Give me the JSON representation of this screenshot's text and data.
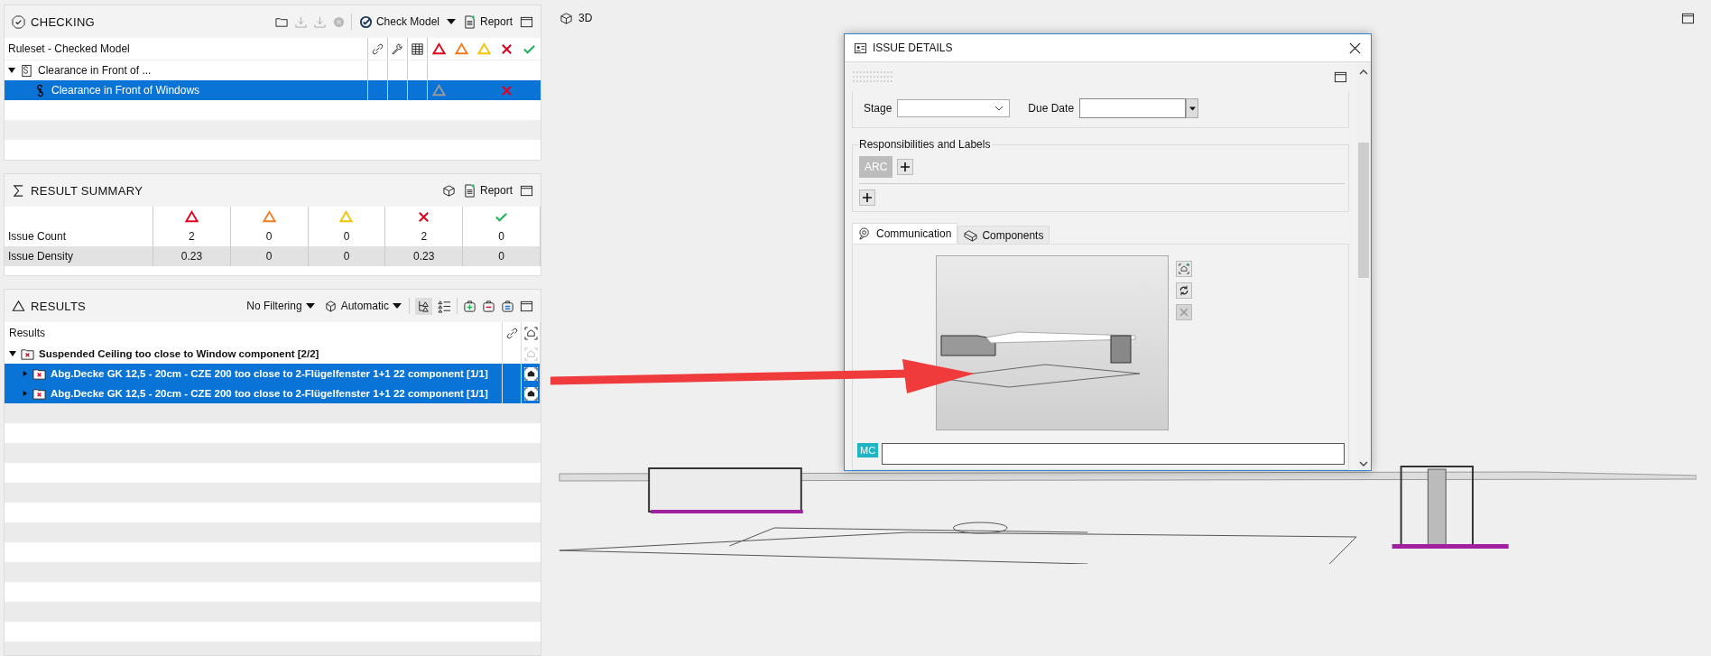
{
  "checking": {
    "title": "CHECKING",
    "check_model": "Check Model",
    "report": "Report",
    "name_column": "Ruleset - Checked Model",
    "severities": [
      {
        "kind": "triangle",
        "color": "#e3001b"
      },
      {
        "kind": "triangle",
        "color": "#f47b20"
      },
      {
        "kind": "triangle",
        "color": "#f2c300"
      },
      {
        "kind": "cross",
        "color": "#e3001b"
      },
      {
        "kind": "check",
        "color": "#1fb35a"
      }
    ],
    "rows": [
      {
        "label": "Clearance in Front of ...",
        "expanded": true,
        "selected": false,
        "marks": [],
        "children": [
          {
            "label": "Clearance in Front of Windows",
            "selected": true,
            "marks": [
              {
                "kind": "triangle"
              },
              {
                "kind": "none"
              },
              {
                "kind": "none"
              },
              {
                "kind": "cross"
              },
              {
                "kind": "none"
              }
            ]
          }
        ]
      }
    ]
  },
  "result_summary": {
    "title": "RESULT SUMMARY",
    "report": "Report",
    "rows": [
      {
        "label": "Issue Count",
        "values": [
          "2",
          "0",
          "0",
          "2",
          "0"
        ]
      },
      {
        "label": "Issue Density",
        "values": [
          "0.23",
          "0",
          "0",
          "0.23",
          "0"
        ]
      }
    ]
  },
  "results": {
    "title": "RESULTS",
    "filter": "No Filtering",
    "mode": "Automatic",
    "column": "Results",
    "groups": [
      {
        "label": "Suspended Ceiling too close to Window component [2/2]",
        "expanded": true,
        "children": [
          {
            "label": "Abg.Decke GK 12,5 - 20cm - CZE 200 too close to 2-Flügelfenster 1+1 22 component [1/1]",
            "expanded": false,
            "selected": true
          },
          {
            "label": "Abg.Decke GK 12,5 - 20cm - CZE 200 too close to 2-Flügelfenster 1+1 22 component [1/1]",
            "expanded": false,
            "selected": true
          }
        ]
      }
    ]
  },
  "viewport": {
    "title": "3D"
  },
  "issue_details": {
    "title": "ISSUE DETAILS",
    "fields": [
      {
        "label": "Stage",
        "kind": "dropdown"
      },
      {
        "label": "Due Date",
        "kind": "date"
      }
    ],
    "responsibilities": {
      "title": "Responsibilities and Labels",
      "labels": [
        "ARC"
      ]
    },
    "tabs": [
      {
        "label": "Communication",
        "selected": true
      },
      {
        "label": "Components",
        "selected": false
      }
    ],
    "comment": {
      "avatar": "MC"
    }
  }
}
